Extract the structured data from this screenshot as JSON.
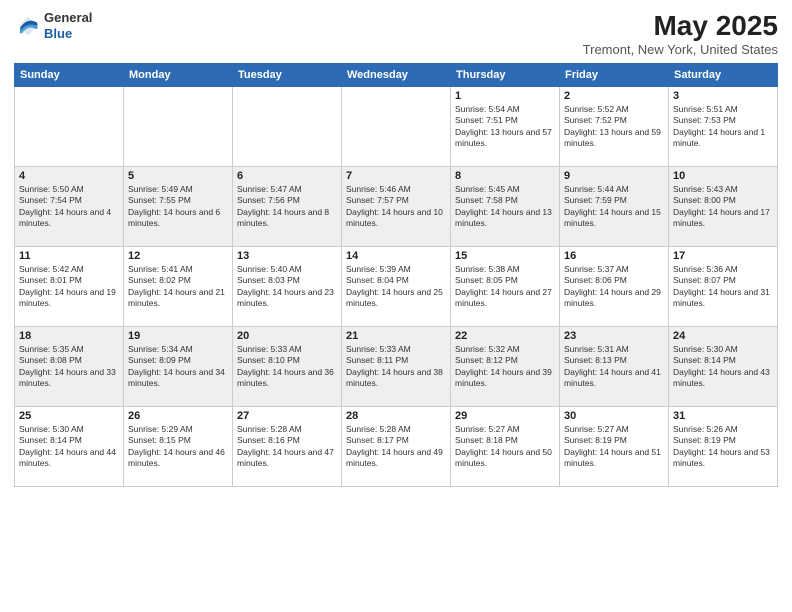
{
  "header": {
    "logo": {
      "general": "General",
      "blue": "Blue"
    },
    "title": "May 2025",
    "location": "Tremont, New York, United States"
  },
  "days_of_week": [
    "Sunday",
    "Monday",
    "Tuesday",
    "Wednesday",
    "Thursday",
    "Friday",
    "Saturday"
  ],
  "weeks": [
    [
      {
        "day": "",
        "sunrise": "",
        "sunset": "",
        "daylight": ""
      },
      {
        "day": "",
        "sunrise": "",
        "sunset": "",
        "daylight": ""
      },
      {
        "day": "",
        "sunrise": "",
        "sunset": "",
        "daylight": ""
      },
      {
        "day": "",
        "sunrise": "",
        "sunset": "",
        "daylight": ""
      },
      {
        "day": "1",
        "sunrise": "Sunrise: 5:54 AM",
        "sunset": "Sunset: 7:51 PM",
        "daylight": "Daylight: 13 hours and 57 minutes."
      },
      {
        "day": "2",
        "sunrise": "Sunrise: 5:52 AM",
        "sunset": "Sunset: 7:52 PM",
        "daylight": "Daylight: 13 hours and 59 minutes."
      },
      {
        "day": "3",
        "sunrise": "Sunrise: 5:51 AM",
        "sunset": "Sunset: 7:53 PM",
        "daylight": "Daylight: 14 hours and 1 minute."
      }
    ],
    [
      {
        "day": "4",
        "sunrise": "Sunrise: 5:50 AM",
        "sunset": "Sunset: 7:54 PM",
        "daylight": "Daylight: 14 hours and 4 minutes."
      },
      {
        "day": "5",
        "sunrise": "Sunrise: 5:49 AM",
        "sunset": "Sunset: 7:55 PM",
        "daylight": "Daylight: 14 hours and 6 minutes."
      },
      {
        "day": "6",
        "sunrise": "Sunrise: 5:47 AM",
        "sunset": "Sunset: 7:56 PM",
        "daylight": "Daylight: 14 hours and 8 minutes."
      },
      {
        "day": "7",
        "sunrise": "Sunrise: 5:46 AM",
        "sunset": "Sunset: 7:57 PM",
        "daylight": "Daylight: 14 hours and 10 minutes."
      },
      {
        "day": "8",
        "sunrise": "Sunrise: 5:45 AM",
        "sunset": "Sunset: 7:58 PM",
        "daylight": "Daylight: 14 hours and 13 minutes."
      },
      {
        "day": "9",
        "sunrise": "Sunrise: 5:44 AM",
        "sunset": "Sunset: 7:59 PM",
        "daylight": "Daylight: 14 hours and 15 minutes."
      },
      {
        "day": "10",
        "sunrise": "Sunrise: 5:43 AM",
        "sunset": "Sunset: 8:00 PM",
        "daylight": "Daylight: 14 hours and 17 minutes."
      }
    ],
    [
      {
        "day": "11",
        "sunrise": "Sunrise: 5:42 AM",
        "sunset": "Sunset: 8:01 PM",
        "daylight": "Daylight: 14 hours and 19 minutes."
      },
      {
        "day": "12",
        "sunrise": "Sunrise: 5:41 AM",
        "sunset": "Sunset: 8:02 PM",
        "daylight": "Daylight: 14 hours and 21 minutes."
      },
      {
        "day": "13",
        "sunrise": "Sunrise: 5:40 AM",
        "sunset": "Sunset: 8:03 PM",
        "daylight": "Daylight: 14 hours and 23 minutes."
      },
      {
        "day": "14",
        "sunrise": "Sunrise: 5:39 AM",
        "sunset": "Sunset: 8:04 PM",
        "daylight": "Daylight: 14 hours and 25 minutes."
      },
      {
        "day": "15",
        "sunrise": "Sunrise: 5:38 AM",
        "sunset": "Sunset: 8:05 PM",
        "daylight": "Daylight: 14 hours and 27 minutes."
      },
      {
        "day": "16",
        "sunrise": "Sunrise: 5:37 AM",
        "sunset": "Sunset: 8:06 PM",
        "daylight": "Daylight: 14 hours and 29 minutes."
      },
      {
        "day": "17",
        "sunrise": "Sunrise: 5:36 AM",
        "sunset": "Sunset: 8:07 PM",
        "daylight": "Daylight: 14 hours and 31 minutes."
      }
    ],
    [
      {
        "day": "18",
        "sunrise": "Sunrise: 5:35 AM",
        "sunset": "Sunset: 8:08 PM",
        "daylight": "Daylight: 14 hours and 33 minutes."
      },
      {
        "day": "19",
        "sunrise": "Sunrise: 5:34 AM",
        "sunset": "Sunset: 8:09 PM",
        "daylight": "Daylight: 14 hours and 34 minutes."
      },
      {
        "day": "20",
        "sunrise": "Sunrise: 5:33 AM",
        "sunset": "Sunset: 8:10 PM",
        "daylight": "Daylight: 14 hours and 36 minutes."
      },
      {
        "day": "21",
        "sunrise": "Sunrise: 5:33 AM",
        "sunset": "Sunset: 8:11 PM",
        "daylight": "Daylight: 14 hours and 38 minutes."
      },
      {
        "day": "22",
        "sunrise": "Sunrise: 5:32 AM",
        "sunset": "Sunset: 8:12 PM",
        "daylight": "Daylight: 14 hours and 39 minutes."
      },
      {
        "day": "23",
        "sunrise": "Sunrise: 5:31 AM",
        "sunset": "Sunset: 8:13 PM",
        "daylight": "Daylight: 14 hours and 41 minutes."
      },
      {
        "day": "24",
        "sunrise": "Sunrise: 5:30 AM",
        "sunset": "Sunset: 8:14 PM",
        "daylight": "Daylight: 14 hours and 43 minutes."
      }
    ],
    [
      {
        "day": "25",
        "sunrise": "Sunrise: 5:30 AM",
        "sunset": "Sunset: 8:14 PM",
        "daylight": "Daylight: 14 hours and 44 minutes."
      },
      {
        "day": "26",
        "sunrise": "Sunrise: 5:29 AM",
        "sunset": "Sunset: 8:15 PM",
        "daylight": "Daylight: 14 hours and 46 minutes."
      },
      {
        "day": "27",
        "sunrise": "Sunrise: 5:28 AM",
        "sunset": "Sunset: 8:16 PM",
        "daylight": "Daylight: 14 hours and 47 minutes."
      },
      {
        "day": "28",
        "sunrise": "Sunrise: 5:28 AM",
        "sunset": "Sunset: 8:17 PM",
        "daylight": "Daylight: 14 hours and 49 minutes."
      },
      {
        "day": "29",
        "sunrise": "Sunrise: 5:27 AM",
        "sunset": "Sunset: 8:18 PM",
        "daylight": "Daylight: 14 hours and 50 minutes."
      },
      {
        "day": "30",
        "sunrise": "Sunrise: 5:27 AM",
        "sunset": "Sunset: 8:19 PM",
        "daylight": "Daylight: 14 hours and 51 minutes."
      },
      {
        "day": "31",
        "sunrise": "Sunrise: 5:26 AM",
        "sunset": "Sunset: 8:19 PM",
        "daylight": "Daylight: 14 hours and 53 minutes."
      }
    ]
  ]
}
